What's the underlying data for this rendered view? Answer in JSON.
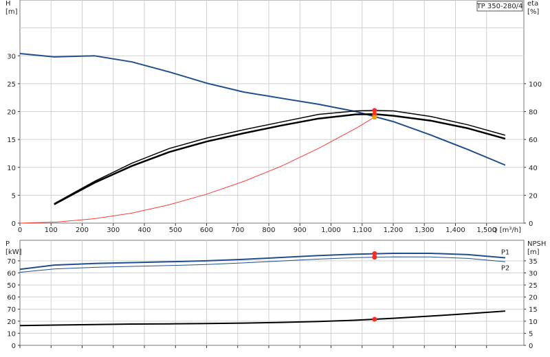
{
  "chart_data": [
    {
      "type": "line",
      "title": "TP 350-280/4",
      "xlabel": "Q [m³/h]",
      "ylabel": "H\n[m]",
      "ylabel_right": "eta\n[%]",
      "xlim": [
        0,
        1620
      ],
      "ylim": [
        0,
        40
      ],
      "ylim_right": [
        0,
        160
      ],
      "x_ticks": [
        0,
        100,
        200,
        300,
        400,
        500,
        600,
        700,
        800,
        900,
        1000,
        1100,
        1200,
        1300,
        1400,
        1500
      ],
      "x_tick_labels": [
        "0",
        "100",
        "200",
        "300",
        "400",
        "500",
        "600",
        "700",
        "800",
        "900",
        "1,000",
        "1,100",
        "1,200",
        "1,300",
        "1,400",
        "1,500"
      ],
      "y_ticks": [
        0,
        5,
        10,
        15,
        20,
        25,
        30
      ],
      "y_ticks_right": [
        0,
        20,
        40,
        60,
        80,
        100
      ],
      "grid": true,
      "series": [
        {
          "axis": "left",
          "color": "#1f4e8c",
          "width": 2,
          "x": [
            0,
            110,
            240,
            360,
            480,
            600,
            720,
            850,
            960,
            1080,
            1200,
            1320,
            1440,
            1560
          ],
          "y": [
            30.4,
            29.8,
            30.0,
            28.9,
            27.1,
            25.1,
            23.5,
            22.3,
            21.3,
            20.0,
            18.2,
            15.8,
            13.2,
            10.4
          ]
        },
        {
          "axis": "right",
          "color": "#000000",
          "width": 1.5,
          "x": [
            110,
            240,
            360,
            480,
            600,
            720,
            840,
            960,
            1080,
            1140,
            1200,
            1320,
            1440,
            1560
          ],
          "y": [
            14,
            30,
            43,
            53.5,
            61,
            67,
            72.5,
            78,
            80.5,
            80.8,
            80.5,
            76.5,
            70.5,
            63
          ]
        },
        {
          "axis": "right",
          "color": "#000000",
          "width": 2.5,
          "x": [
            110,
            240,
            360,
            480,
            600,
            720,
            840,
            960,
            1080,
            1140,
            1200,
            1320,
            1440,
            1560
          ],
          "y": [
            13.5,
            29,
            41,
            51,
            58.5,
            64.5,
            70,
            75,
            78,
            78.2,
            77,
            73.5,
            68,
            60.5
          ]
        },
        {
          "axis": "left",
          "color": "#ff3b30",
          "width": 1,
          "x": [
            0,
            120,
            240,
            360,
            480,
            600,
            720,
            840,
            960,
            1080,
            1140
          ],
          "y": [
            0,
            0.2,
            0.8,
            1.8,
            3.3,
            5.2,
            7.5,
            10.2,
            13.4,
            17.0,
            19.0
          ]
        }
      ],
      "operating_points": [
        {
          "x": 1140,
          "y": 20.2,
          "color": "#ff2a1a",
          "axis": "left"
        },
        {
          "x": 1140,
          "y": 19.5,
          "color": "#ff2a1a",
          "axis": "left"
        },
        {
          "x": 1140,
          "y": 19.0,
          "color": "#ff9900",
          "axis": "left"
        }
      ]
    },
    {
      "type": "line",
      "xlabel": "",
      "ylabel": "P\n[kW]",
      "ylabel_right": "NPSH\n[m]",
      "xlim": [
        0,
        1620
      ],
      "ylim": [
        0,
        87
      ],
      "ylim_right": [
        0,
        43.5
      ],
      "y_ticks": [
        0,
        10,
        20,
        30,
        40,
        50,
        60,
        70
      ],
      "y_tick_labels": [
        "0",
        "10",
        "20",
        "70",
        "60",
        "50",
        "60",
        "70"
      ],
      "y_ticks_right": [
        0,
        5,
        10,
        15,
        20,
        25,
        30,
        35
      ],
      "grid": true,
      "series": [
        {
          "name": "P1",
          "axis": "left",
          "color": "#1f4e8c",
          "width": 2,
          "x": [
            0,
            110,
            240,
            360,
            480,
            600,
            720,
            840,
            960,
            1080,
            1200,
            1320,
            1440,
            1560
          ],
          "y": [
            63,
            66.5,
            67.8,
            68.5,
            69.2,
            70,
            71.2,
            72.8,
            74.3,
            75.5,
            76.2,
            76.2,
            75.1,
            72.5
          ]
        },
        {
          "name": "P2",
          "axis": "left",
          "color": "#1f4e8c",
          "width": 1,
          "x": [
            0,
            110,
            240,
            360,
            480,
            600,
            720,
            840,
            960,
            1080,
            1200,
            1320,
            1440,
            1560
          ],
          "y": [
            60.5,
            63.3,
            64.6,
            65.4,
            66.1,
            67,
            68.3,
            69.9,
            71.4,
            72.6,
            73.3,
            73.2,
            72,
            69.2
          ]
        },
        {
          "name": "",
          "axis": "right",
          "color": "#000000",
          "width": 2,
          "x": [
            0,
            110,
            240,
            360,
            480,
            600,
            720,
            840,
            960,
            1080,
            1140,
            1200,
            1320,
            1440,
            1560
          ],
          "y": [
            8.2,
            8.4,
            8.6,
            8.8,
            8.9,
            9.0,
            9.2,
            9.5,
            9.9,
            10.4,
            10.8,
            11.2,
            12.1,
            13.1,
            14.2
          ]
        }
      ],
      "operating_points": [
        {
          "x": 1140,
          "y": 76.0,
          "color": "#ff2a1a",
          "axis": "left"
        },
        {
          "x": 1140,
          "y": 73.0,
          "color": "#ff2a1a",
          "axis": "left"
        },
        {
          "x": 1140,
          "y": 10.8,
          "color": "#ff2a1a",
          "axis": "right"
        }
      ]
    }
  ]
}
